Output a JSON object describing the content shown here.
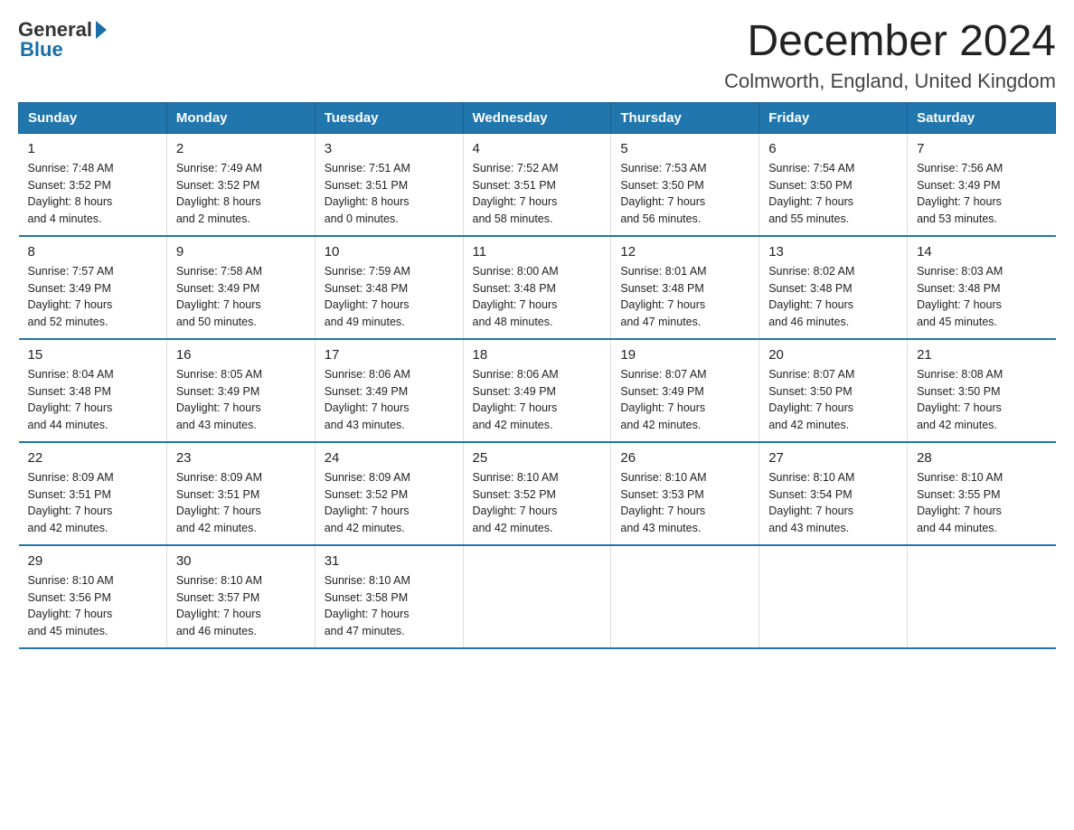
{
  "header": {
    "logo_general": "General",
    "logo_blue": "Blue",
    "title": "December 2024",
    "subtitle": "Colmworth, England, United Kingdom"
  },
  "days_of_week": [
    "Sunday",
    "Monday",
    "Tuesday",
    "Wednesday",
    "Thursday",
    "Friday",
    "Saturday"
  ],
  "weeks": [
    [
      {
        "day": "1",
        "sunrise": "7:48 AM",
        "sunset": "3:52 PM",
        "daylight": "8 hours and 4 minutes."
      },
      {
        "day": "2",
        "sunrise": "7:49 AM",
        "sunset": "3:52 PM",
        "daylight": "8 hours and 2 minutes."
      },
      {
        "day": "3",
        "sunrise": "7:51 AM",
        "sunset": "3:51 PM",
        "daylight": "8 hours and 0 minutes."
      },
      {
        "day": "4",
        "sunrise": "7:52 AM",
        "sunset": "3:51 PM",
        "daylight": "7 hours and 58 minutes."
      },
      {
        "day": "5",
        "sunrise": "7:53 AM",
        "sunset": "3:50 PM",
        "daylight": "7 hours and 56 minutes."
      },
      {
        "day": "6",
        "sunrise": "7:54 AM",
        "sunset": "3:50 PM",
        "daylight": "7 hours and 55 minutes."
      },
      {
        "day": "7",
        "sunrise": "7:56 AM",
        "sunset": "3:49 PM",
        "daylight": "7 hours and 53 minutes."
      }
    ],
    [
      {
        "day": "8",
        "sunrise": "7:57 AM",
        "sunset": "3:49 PM",
        "daylight": "7 hours and 52 minutes."
      },
      {
        "day": "9",
        "sunrise": "7:58 AM",
        "sunset": "3:49 PM",
        "daylight": "7 hours and 50 minutes."
      },
      {
        "day": "10",
        "sunrise": "7:59 AM",
        "sunset": "3:48 PM",
        "daylight": "7 hours and 49 minutes."
      },
      {
        "day": "11",
        "sunrise": "8:00 AM",
        "sunset": "3:48 PM",
        "daylight": "7 hours and 48 minutes."
      },
      {
        "day": "12",
        "sunrise": "8:01 AM",
        "sunset": "3:48 PM",
        "daylight": "7 hours and 47 minutes."
      },
      {
        "day": "13",
        "sunrise": "8:02 AM",
        "sunset": "3:48 PM",
        "daylight": "7 hours and 46 minutes."
      },
      {
        "day": "14",
        "sunrise": "8:03 AM",
        "sunset": "3:48 PM",
        "daylight": "7 hours and 45 minutes."
      }
    ],
    [
      {
        "day": "15",
        "sunrise": "8:04 AM",
        "sunset": "3:48 PM",
        "daylight": "7 hours and 44 minutes."
      },
      {
        "day": "16",
        "sunrise": "8:05 AM",
        "sunset": "3:49 PM",
        "daylight": "7 hours and 43 minutes."
      },
      {
        "day": "17",
        "sunrise": "8:06 AM",
        "sunset": "3:49 PM",
        "daylight": "7 hours and 43 minutes."
      },
      {
        "day": "18",
        "sunrise": "8:06 AM",
        "sunset": "3:49 PM",
        "daylight": "7 hours and 42 minutes."
      },
      {
        "day": "19",
        "sunrise": "8:07 AM",
        "sunset": "3:49 PM",
        "daylight": "7 hours and 42 minutes."
      },
      {
        "day": "20",
        "sunrise": "8:07 AM",
        "sunset": "3:50 PM",
        "daylight": "7 hours and 42 minutes."
      },
      {
        "day": "21",
        "sunrise": "8:08 AM",
        "sunset": "3:50 PM",
        "daylight": "7 hours and 42 minutes."
      }
    ],
    [
      {
        "day": "22",
        "sunrise": "8:09 AM",
        "sunset": "3:51 PM",
        "daylight": "7 hours and 42 minutes."
      },
      {
        "day": "23",
        "sunrise": "8:09 AM",
        "sunset": "3:51 PM",
        "daylight": "7 hours and 42 minutes."
      },
      {
        "day": "24",
        "sunrise": "8:09 AM",
        "sunset": "3:52 PM",
        "daylight": "7 hours and 42 minutes."
      },
      {
        "day": "25",
        "sunrise": "8:10 AM",
        "sunset": "3:52 PM",
        "daylight": "7 hours and 42 minutes."
      },
      {
        "day": "26",
        "sunrise": "8:10 AM",
        "sunset": "3:53 PM",
        "daylight": "7 hours and 43 minutes."
      },
      {
        "day": "27",
        "sunrise": "8:10 AM",
        "sunset": "3:54 PM",
        "daylight": "7 hours and 43 minutes."
      },
      {
        "day": "28",
        "sunrise": "8:10 AM",
        "sunset": "3:55 PM",
        "daylight": "7 hours and 44 minutes."
      }
    ],
    [
      {
        "day": "29",
        "sunrise": "8:10 AM",
        "sunset": "3:56 PM",
        "daylight": "7 hours and 45 minutes."
      },
      {
        "day": "30",
        "sunrise": "8:10 AM",
        "sunset": "3:57 PM",
        "daylight": "7 hours and 46 minutes."
      },
      {
        "day": "31",
        "sunrise": "8:10 AM",
        "sunset": "3:58 PM",
        "daylight": "7 hours and 47 minutes."
      },
      null,
      null,
      null,
      null
    ]
  ]
}
